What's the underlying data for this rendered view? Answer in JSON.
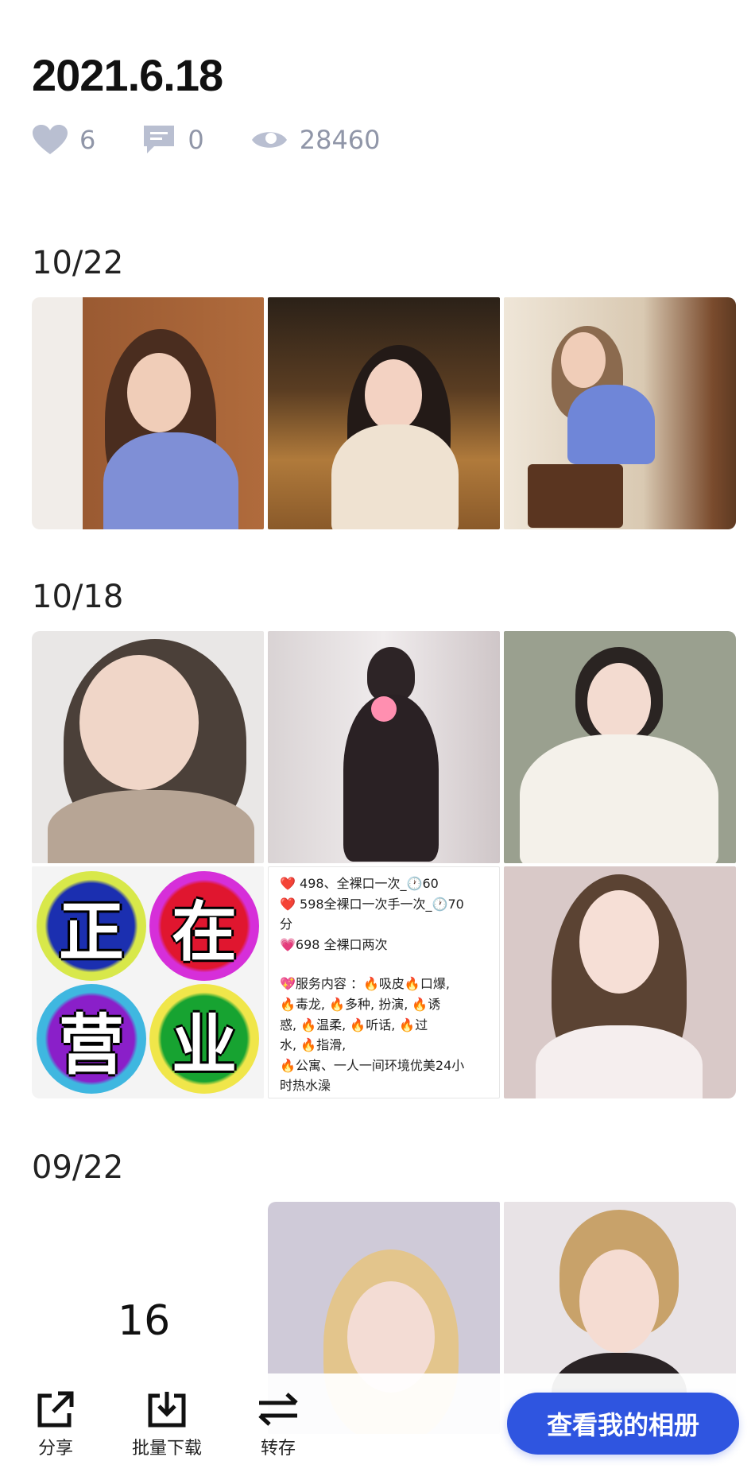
{
  "album": {
    "title": "2021.6.18"
  },
  "stats": {
    "likes": "6",
    "comments": "0",
    "views": "28460"
  },
  "sections": [
    {
      "date": "10/22"
    },
    {
      "date": "10/18"
    },
    {
      "date": "09/22"
    }
  ],
  "sign_chars": [
    "正",
    "在",
    "营",
    "业"
  ],
  "text_card_lines": [
    "❤️  498、全裸口一次_🕐60",
    "❤️  598全裸口一次手一次_🕐70",
    "分",
    "💗698 全裸口两次",
    "💖服务内容 ：🔥吸皮🔥口爆,",
    "🔥毒龙, 🔥多种, 扮演, 🔥诱",
    "惑, 🔥温柔, 🔥听话, 🔥过",
    "水, 🔥指滑,",
    "🔥公寓、一人一间环境优美24小",
    "时热水澡"
  ],
  "count_label": "16",
  "toolbar": {
    "share": "分享",
    "batch_download": "批量下载",
    "transfer": "转存"
  },
  "cta": {
    "label": "查看我的相册"
  },
  "colors": {
    "icon_gray": "#b9bfd1",
    "accent": "#2f55e0"
  }
}
